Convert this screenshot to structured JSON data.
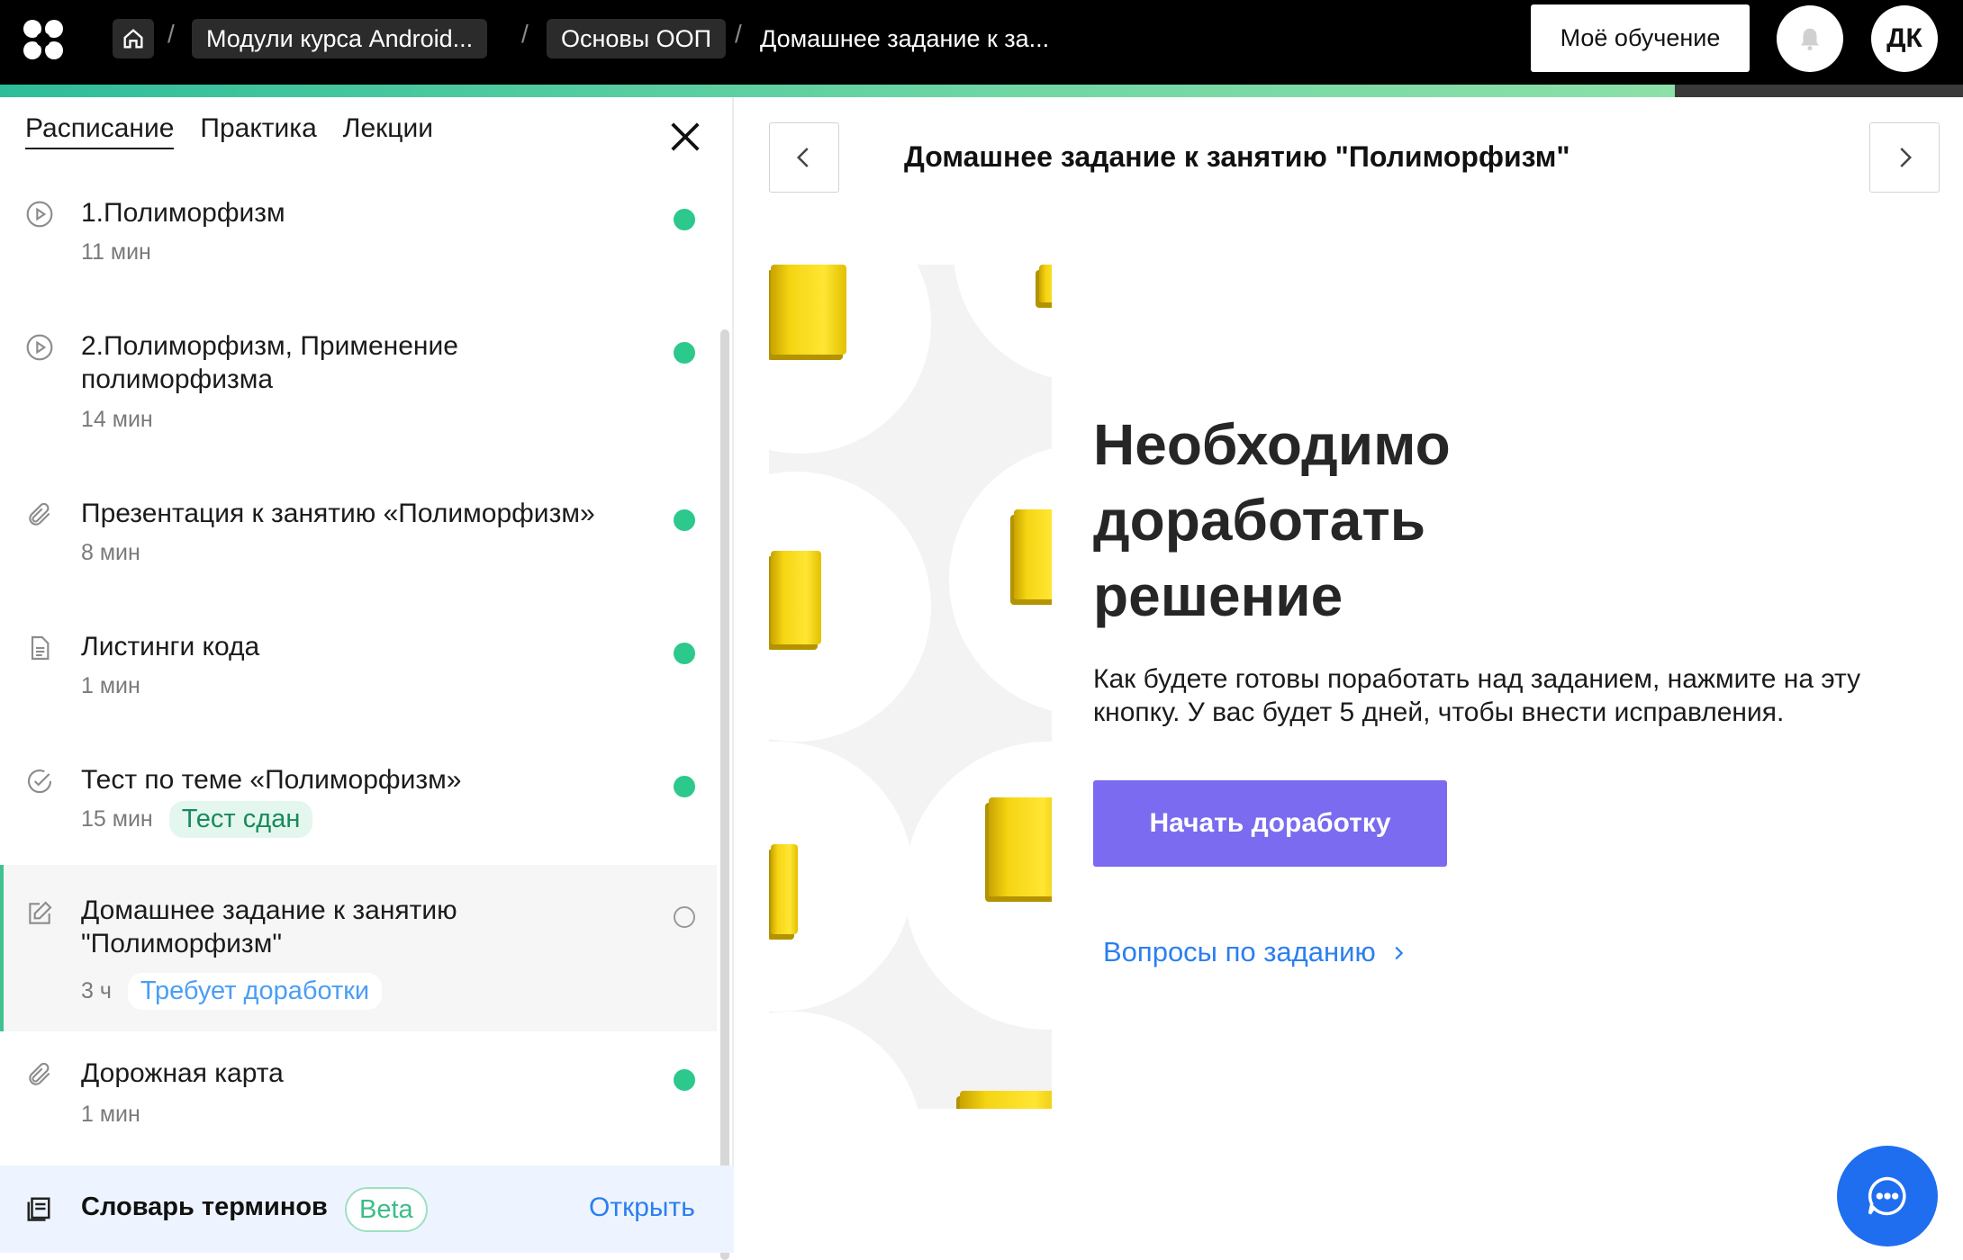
{
  "header": {
    "breadcrumbs": [
      "Модули курса Android...",
      "Основы ООП",
      "Домашнее задание к за..."
    ],
    "separator": "/",
    "my_learning": "Моё обучение",
    "avatar_initials": "ДК",
    "progress_fraction": 0.853
  },
  "sidebar": {
    "tabs": [
      {
        "label": "Расписание",
        "active": true
      },
      {
        "label": "Практика",
        "active": false
      },
      {
        "label": "Лекции",
        "active": false
      }
    ],
    "items": [
      {
        "icon": "play-circle-icon",
        "title": "1.Полиморфизм",
        "duration": "11 мин",
        "status": "done"
      },
      {
        "icon": "play-circle-icon",
        "title": "2.Полиморфизм, Применение полиморфизма",
        "duration": "14 мин",
        "status": "done"
      },
      {
        "icon": "paperclip-icon",
        "title": "Презентация к занятию «Полиморфизм»",
        "duration": "8 мин",
        "status": "done"
      },
      {
        "icon": "document-icon",
        "title": "Листинги кода",
        "duration": "1 мин",
        "status": "done"
      },
      {
        "icon": "check-circle-icon",
        "title": "Тест по теме «Полиморфизм»",
        "duration": "15 мин",
        "badge": "Тест сдан",
        "status": "done"
      },
      {
        "icon": "edit-icon",
        "title": "Домашнее задание к занятию \"Полиморфизм\"",
        "duration": "3 ч",
        "badge": "Требует доработки",
        "status": "pending",
        "active": true
      },
      {
        "icon": "paperclip-icon",
        "title": "Дорожная карта",
        "duration": "1 мин",
        "status": "done"
      }
    ],
    "glossary": {
      "label": "Словарь терминов",
      "beta": "Beta",
      "open": "Открыть"
    }
  },
  "main": {
    "title": "Домашнее задание к занятию \"Полиморфизм\"",
    "heading": "Необходимо доработать решение",
    "description": "Как будете готовы поработать над заданием, нажмите на эту кнопку. У вас будет 5 дней, чтобы внести исправления.",
    "primary_button": "Начать доработку",
    "questions_link": "Вопросы по заданию"
  },
  "colors": {
    "accent": "#7a6bf0",
    "link": "#2b7ff0",
    "done": "#2cc88c",
    "progress": "#6fd6a4"
  }
}
